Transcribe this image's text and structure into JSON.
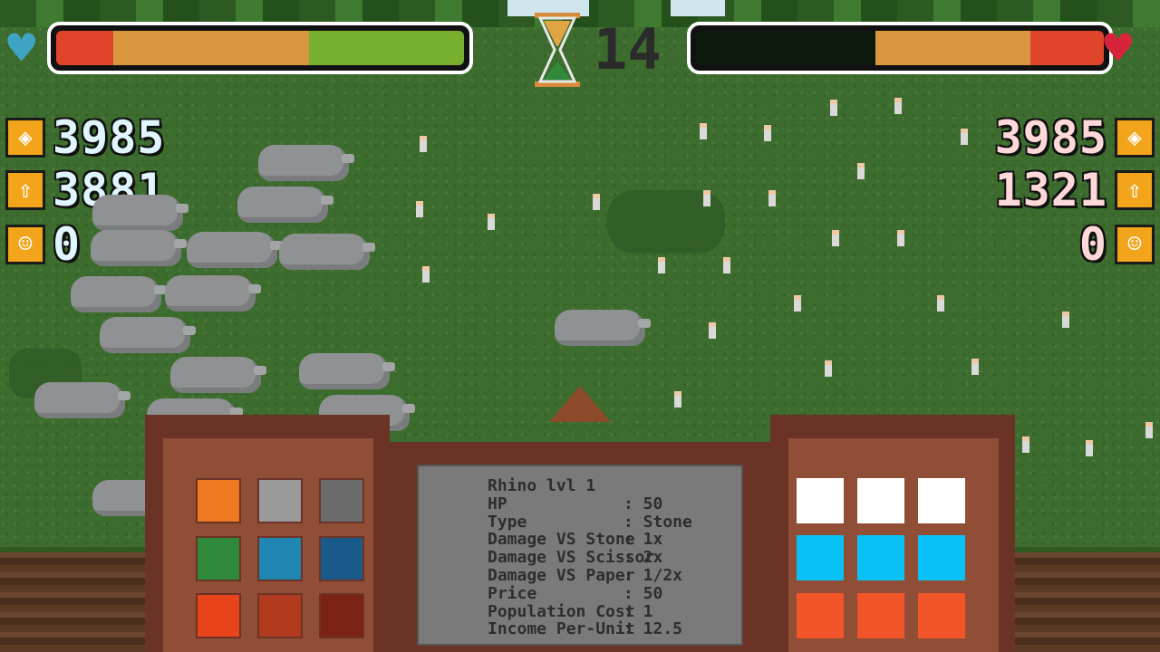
{
  "hud": {
    "timer": "14",
    "player_bar": {
      "health_fraction": 0.62,
      "colors": {
        "left": "#e0442a",
        "mid": "#d9963f",
        "right": "#77b02e"
      }
    },
    "enemy_bar": {
      "health_fraction": 0.56,
      "colors": {
        "dark": "#0c1a0e",
        "mid": "#d9963f",
        "right": "#e0442a"
      }
    },
    "player_heart_color": "#3fa3c4",
    "enemy_heart_color": "#d8243a"
  },
  "player_stats": [
    {
      "icon": "gold-icon",
      "value": "3985"
    },
    {
      "icon": "income-arrow-icon",
      "value": "3881"
    },
    {
      "icon": "population-icon",
      "value": "0"
    }
  ],
  "enemy_stats": [
    {
      "icon": "gold-icon",
      "value": "3985"
    },
    {
      "icon": "income-arrow-icon",
      "value": "1321"
    },
    {
      "icon": "population-icon",
      "value": "0"
    }
  ],
  "unit_grid": [
    {
      "name": "stone-golem",
      "color": "#ef7a22"
    },
    {
      "name": "stone-rhino",
      "color": "#9a9a9a"
    },
    {
      "name": "stone-bird",
      "color": "#6b6b6b"
    },
    {
      "name": "scissor-golem",
      "color": "#2e8a3a"
    },
    {
      "name": "scissor-rhino",
      "color": "#1e86b0"
    },
    {
      "name": "scissor-bird",
      "color": "#1a5a8a"
    },
    {
      "name": "paper-golem",
      "color": "#e8431a"
    },
    {
      "name": "paper-rhino",
      "color": "#b23a1e"
    },
    {
      "name": "paper-bird",
      "color": "#7a2214"
    }
  ],
  "info": {
    "title": "Rhino lvl 1",
    "rows": [
      {
        "k": "HP",
        "v": ": 50"
      },
      {
        "k": "Type",
        "v": ": Stone"
      },
      {
        "k": "Damage VS Stone",
        "v": ": 1x"
      },
      {
        "k": "Damage VS Scissor",
        "v": ": 2x"
      },
      {
        "k": "Damage VS Paper",
        "v": ": 1/2x"
      },
      {
        "k": "Price",
        "v": ": 50"
      },
      {
        "k": "Population Cost",
        "v": ": 1"
      },
      {
        "k": "Income Per-Unit",
        "v": ": 12.5"
      }
    ]
  },
  "color_grid": [
    "#ffffff",
    "#ffffff",
    "#ffffff",
    "#0ac1f7",
    "#0ac1f7",
    "#0ac1f7",
    "#f2552a",
    "#f2552a",
    "#f2552a"
  ]
}
